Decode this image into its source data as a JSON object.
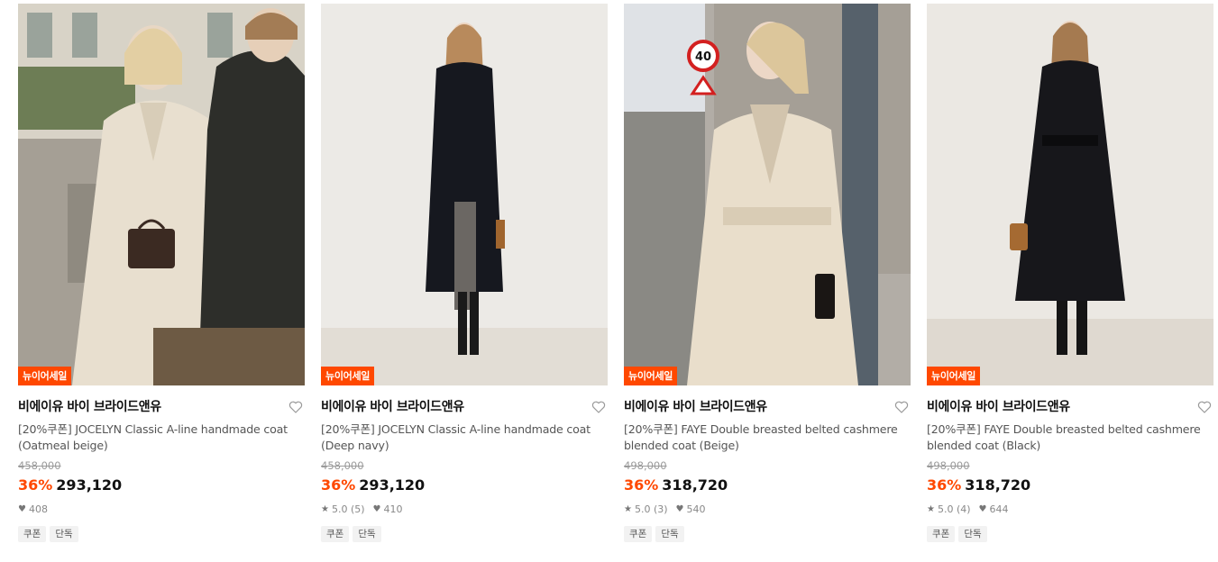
{
  "products": [
    {
      "badge": "뉴이어세일",
      "brand": "비에이유 바이 브라이드앤유",
      "title": "[20%쿠폰] JOCELYN Classic A-line handmade coat (Oatmeal beige)",
      "original_price": "458,000",
      "discount": "36%",
      "price": "293,120",
      "rating": "",
      "likes": "408",
      "tags": [
        "쿠폰",
        "단독"
      ],
      "image": {
        "bg": "#c9c3b8",
        "coat": "#e6ddcd",
        "scene": "outdoor-street-couple"
      }
    },
    {
      "badge": "뉴이어세일",
      "brand": "비에이유 바이 브라이드앤유",
      "title": "[20%쿠폰] JOCELYN Classic A-line handmade coat (Deep navy)",
      "original_price": "458,000",
      "discount": "36%",
      "price": "293,120",
      "rating": "5.0 (5)",
      "likes": "410",
      "tags": [
        "쿠폰",
        "단독"
      ],
      "image": {
        "bg": "#eeece8",
        "coat": "#15171f",
        "scene": "studio-wall"
      }
    },
    {
      "badge": "뉴이어세일",
      "brand": "비에이유 바이 브라이드앤유",
      "title": "[20%쿠폰] FAYE Double breasted belted cashmere blended coat (Beige)",
      "original_price": "498,000",
      "discount": "36%",
      "price": "318,720",
      "rating": "5.0 (3)",
      "likes": "540",
      "tags": [
        "쿠폰",
        "단독"
      ],
      "image": {
        "bg": "#b9b4ad",
        "coat": "#e8dcc8",
        "scene": "outdoor-street-pole"
      }
    },
    {
      "badge": "뉴이어세일",
      "brand": "비에이유 바이 브라이드앤유",
      "title": "[20%쿠폰] FAYE Double breasted belted cashmere blended coat (Black)",
      "original_price": "498,000",
      "discount": "36%",
      "price": "318,720",
      "rating": "5.0 (4)",
      "likes": "644",
      "tags": [
        "쿠폰",
        "단독"
      ],
      "image": {
        "bg": "#ece9e4",
        "coat": "#16161a",
        "scene": "studio-wall"
      }
    }
  ],
  "colors": {
    "accent": "#ff4800",
    "text": "#111111",
    "muted": "#9a9a9a",
    "tag_bg": "#f2f2f2"
  },
  "sign_text": "40"
}
